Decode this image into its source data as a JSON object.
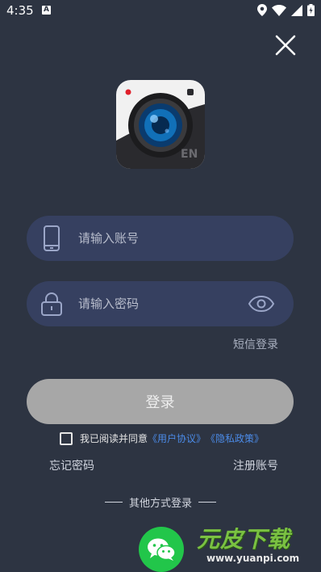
{
  "status_bar": {
    "time": "4:35",
    "notif_letter": "A"
  },
  "login": {
    "account_placeholder": "请输入账号",
    "password_placeholder": "请输入密码",
    "sms_login": "短信登录",
    "login_button": "登录",
    "agree_prefix": "我已阅读并同意",
    "user_agreement": "《用户协议》",
    "privacy_policy": "《隐私政策》",
    "forgot_password": "忘记密码",
    "register": "注册账号",
    "other_methods": "其他方式登录"
  },
  "logo": {
    "badge": "EN"
  },
  "watermark": {
    "brand": "元皮下载",
    "url": "www.yuanpi.com"
  },
  "colors": {
    "background": "#2d3442",
    "field": "#364060",
    "login_button": "#a7a7a7",
    "link": "#4b8be8",
    "wechat": "#22c64a"
  }
}
